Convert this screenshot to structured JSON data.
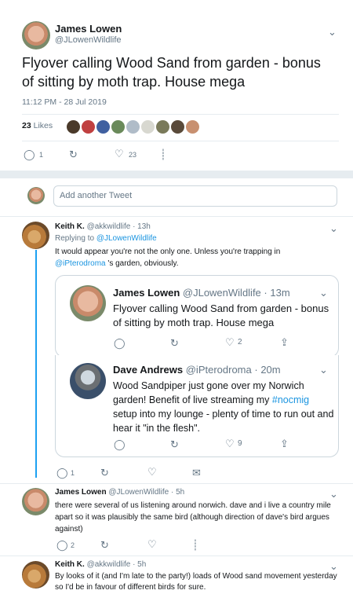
{
  "main_tweet": {
    "author_name": "James Lowen",
    "author_handle": "@JLowenWildlife",
    "text": "Flyover calling Wood Sand from garden - bonus of sitting by moth trap. House mega",
    "timestamp": "11:12 PM - 28 Jul 2019",
    "likes_count": "23",
    "likes_label": "Likes",
    "reply_count": "1",
    "like_count": "23"
  },
  "compose": {
    "placeholder": "Add another Tweet"
  },
  "replies": [
    {
      "author_name": "Keith K.",
      "author_handle": "@akkwildlife",
      "time": "· 13h",
      "replying_to_label": "Replying to",
      "replying_to_handle": "@JLowenWildlife",
      "text_line1": "It would appear you're not the only one. Unless you're trapping in",
      "mention": "@iPterodroma",
      "text_line2": " 's garden, obviously.",
      "reply_count": "1"
    },
    {
      "author_name": "James Lowen",
      "author_handle": "@JLowenWildlife",
      "time": "· 5h",
      "text": "there were several of us listening around norwich. dave and i live a country mile apart so it was plausibly the same bird (although direction of dave's bird argues against)",
      "reply_count": "2"
    },
    {
      "author_name": "Keith K.",
      "author_handle": "@akkwildlife",
      "time": "· 5h",
      "text": "By looks of it (and I'm late to the party!) loads of Wood sand movement yesterday so I'd be in favour of different birds for sure."
    }
  ],
  "quoted_1": {
    "author_name": "James Lowen",
    "author_handle": "@JLowenWildlife",
    "time": "· 13m",
    "text": "Flyover calling Wood Sand from garden - bonus of sitting by moth trap. House mega",
    "like_count": "2"
  },
  "quoted_2": {
    "author_name": "Dave Andrews",
    "author_handle": "@iPterodroma",
    "time": "· 20m",
    "text_before": "Wood Sandpiper just gone over my Norwich garden! Benefit of live streaming my ",
    "hashtag": "#nocmig",
    "text_after": " setup into my lounge - plenty of time to run out and hear it \"in the flesh\".",
    "like_count": "9"
  },
  "colors": {
    "link": "#1b95e0",
    "muted": "#657786",
    "thread_line": "#1da1f2"
  }
}
